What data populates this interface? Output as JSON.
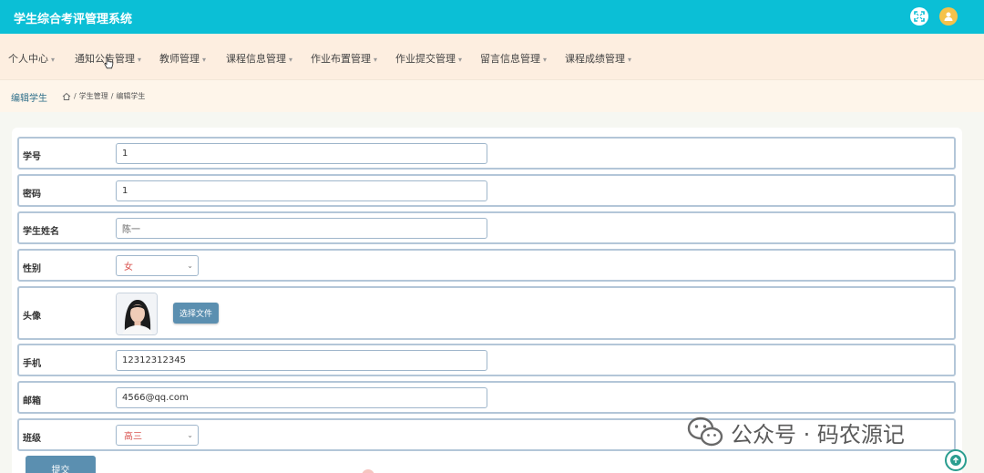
{
  "app": {
    "title": "学生综合考评管理系统"
  },
  "nav": {
    "items": [
      {
        "label": "个人中心"
      },
      {
        "label": "通知公告管理"
      },
      {
        "label": "教师管理"
      },
      {
        "label": "课程信息管理"
      },
      {
        "label": "作业布置管理"
      },
      {
        "label": "作业提交管理"
      },
      {
        "label": "留言信息管理"
      },
      {
        "label": "课程成绩管理"
      }
    ]
  },
  "breadcrumb": {
    "title": "编辑学生",
    "sep": "/",
    "path1": "学生管理",
    "path2": "编辑学生"
  },
  "form": {
    "student_no_label": "学号",
    "student_no_value": "1",
    "password_label": "密码",
    "password_value": "1",
    "name_label": "学生姓名",
    "name_value": "陈一",
    "gender_label": "性别",
    "gender_value": "女",
    "avatar_label": "头像",
    "file_button": "选择文件",
    "phone_label": "手机",
    "phone_value": "12312312345",
    "email_label": "邮箱",
    "email_value": "4566@qq.com",
    "class_label": "班级",
    "class_value": "高三",
    "submit_label": "提交"
  },
  "watermark": {
    "text": "公众号 · 码农源记"
  },
  "icons": {
    "fullscreen": "fullscreen-icon",
    "avatar": "user-avatar-icon",
    "home": "home-icon",
    "caret": "caret-down-icon",
    "scroll_top": "arrow-up-icon",
    "wechat": "wechat-icon"
  },
  "colors": {
    "topbar": "#0bbfd6",
    "navbar": "#fdeee0",
    "button": "#5b8fb0",
    "select_text": "#d9534f"
  }
}
